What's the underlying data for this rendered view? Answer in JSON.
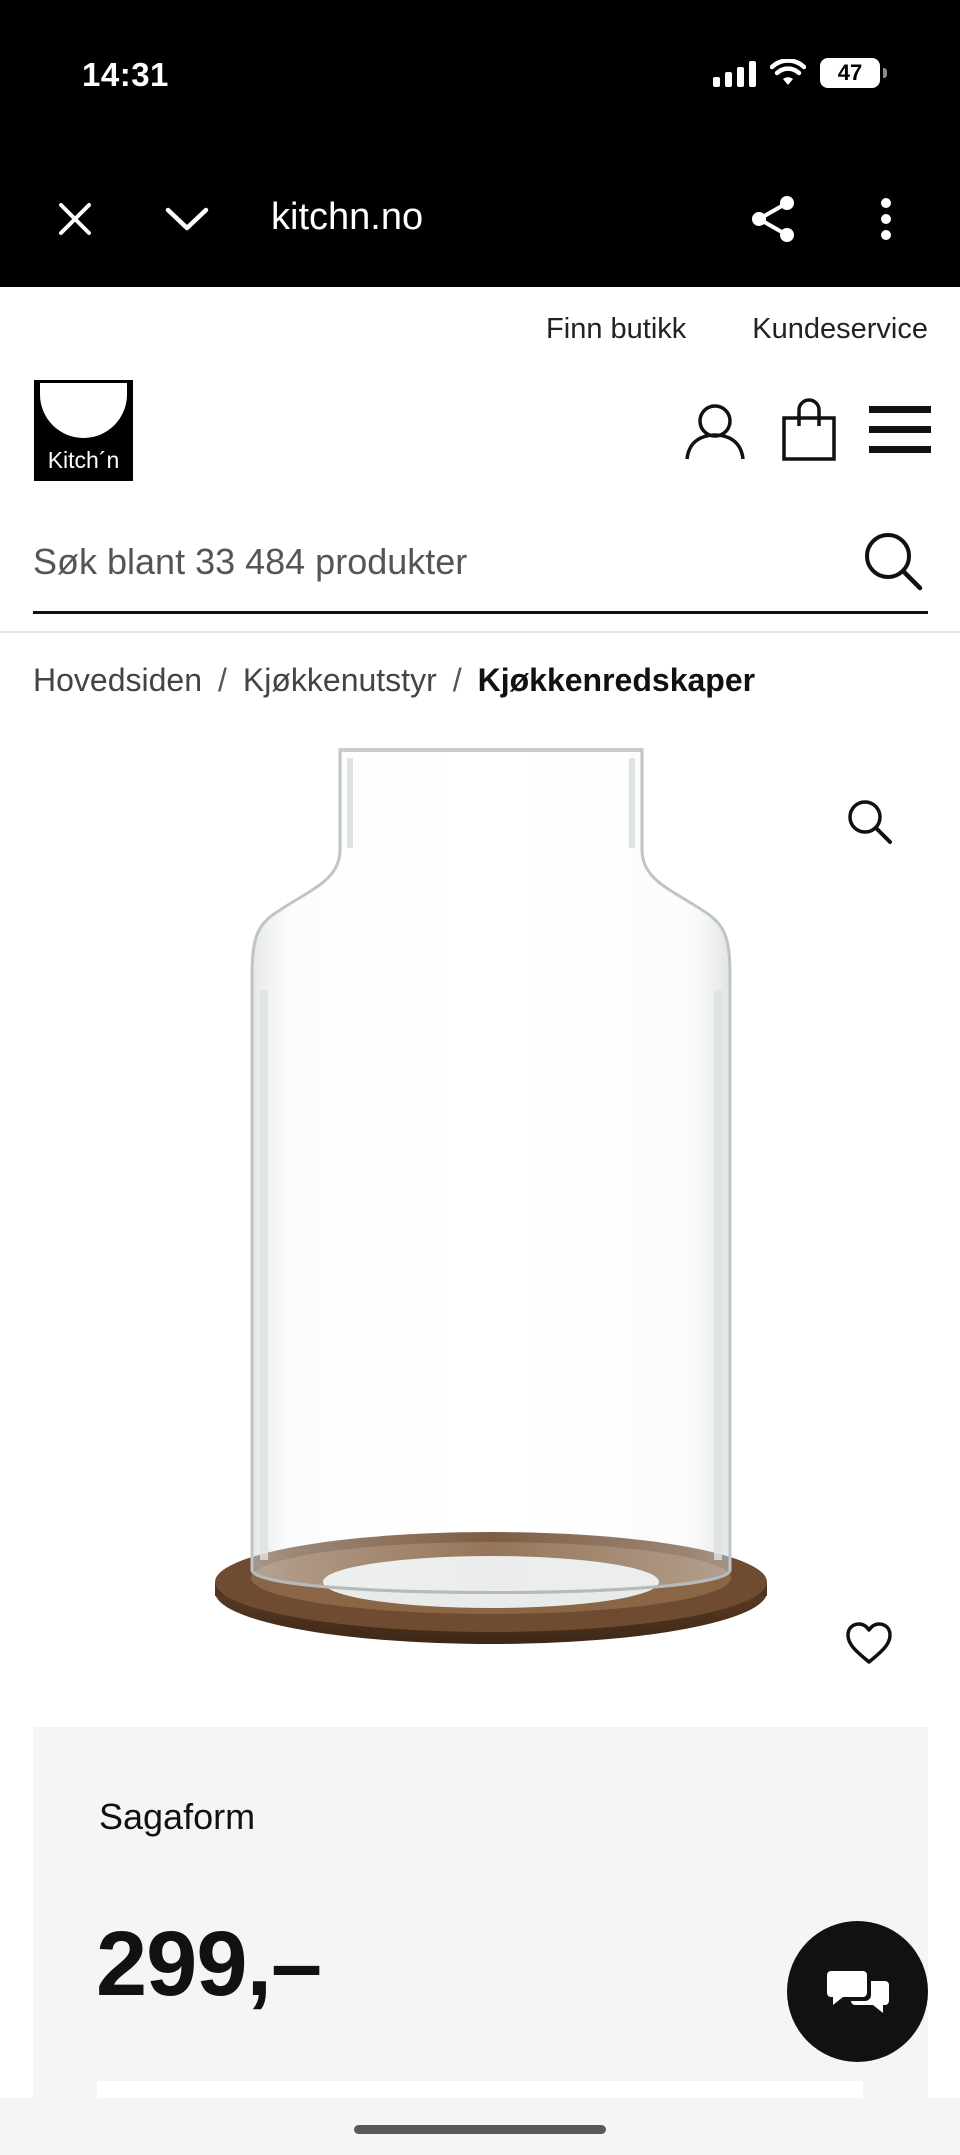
{
  "status_bar": {
    "time": "14:31",
    "battery": "47"
  },
  "browser": {
    "url": "kitchn.no"
  },
  "header": {
    "links": [
      "Finn butikk",
      "Kundeservice"
    ],
    "logo_text": "Kitch´n"
  },
  "search": {
    "placeholder": "Søk blant 33 484 produkter"
  },
  "breadcrumb": {
    "items": [
      "Hovedsiden",
      "Kjøkkenutstyr",
      "Kjøkkenredskaper"
    ],
    "separator": "/"
  },
  "product": {
    "brand": "Sagaform",
    "price": "299,–"
  },
  "icons": {
    "close": "close-icon",
    "collapse": "chevron-down-icon",
    "share": "share-icon",
    "more": "more-vertical-icon",
    "account": "user-icon",
    "cart": "shopping-bag-icon",
    "menu": "hamburger-menu-icon",
    "search": "search-icon",
    "zoom": "zoom-icon",
    "favorite": "heart-icon",
    "chat": "chat-icon"
  }
}
